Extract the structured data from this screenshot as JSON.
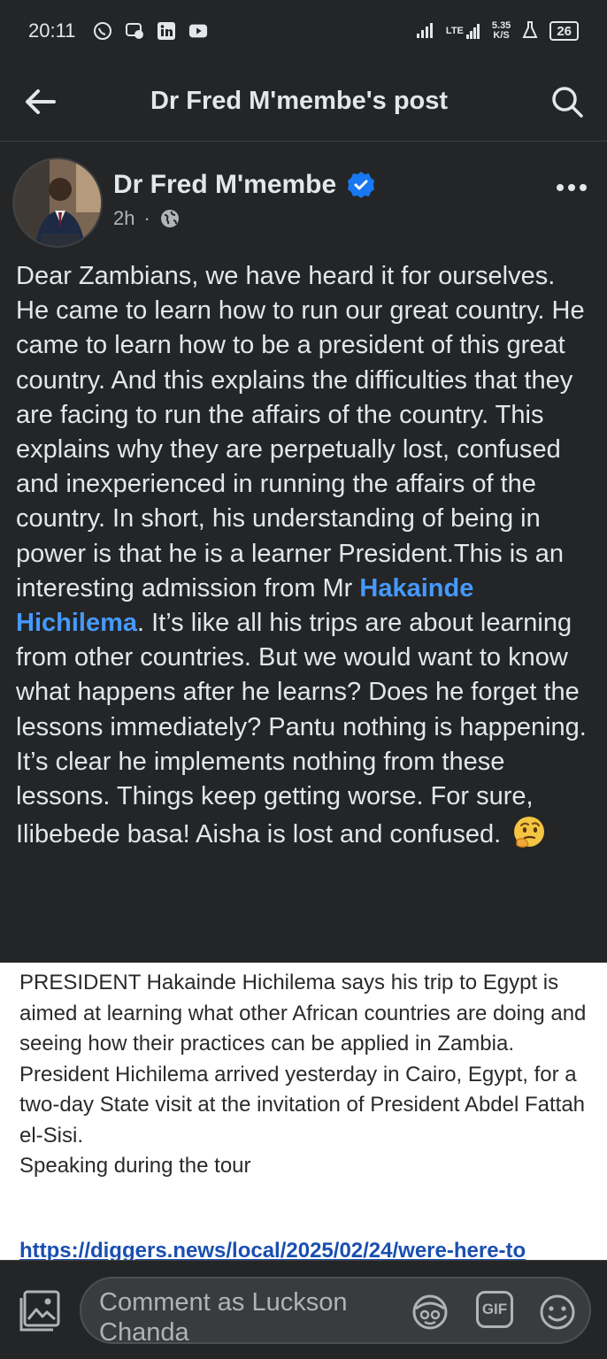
{
  "status_bar": {
    "time": "20:11",
    "net_speed_value": "5.35",
    "net_speed_unit": "K/S",
    "network": "LTE",
    "battery": "26"
  },
  "header": {
    "title": "Dr Fred M'membe's post"
  },
  "post": {
    "author": "Dr Fred M'membe",
    "time": "2h",
    "text_before_mention": "Dear Zambians, we have heard it for ourselves. He came to learn how to run our great country. He came to learn how to be a president of this great country. And this explains the difficulties that they are facing to run the affairs of the country. This explains why they are perpetually lost, confused and inexperienced in running the affairs of the country. In short, his understanding of being in power is that he is a learner President.This is an interesting admission from Mr ",
    "mention": "Hakainde Hichilema",
    "text_after_mention": ". It’s like all his trips are about learning from other countries. But we would want to know what happens after he learns? Does he forget the lessons immediately? Pantu nothing is happening. It’s clear he implements nothing from these lessons. Things keep getting worse. For sure, Ilibebede basa! Aisha is lost and confused. ",
    "emoji": "thinking-face"
  },
  "attachment": {
    "paragraph1": "PRESIDENT Hakainde Hichilema says his trip to Egypt is aimed at learning what other African countries are doing and seeing how their practices can be applied in Zambia.",
    "paragraph2": "President Hichilema arrived yesterday in Cairo, Egypt, for a two-day State visit at the invitation of President Abdel Fattah el-Sisi.",
    "paragraph3": "Speaking during the tour",
    "link": "https://diggers.news/local/2025/02/24/were-here-to"
  },
  "comment_bar": {
    "placeholder": "Comment as Luckson Chanda",
    "gif_label": "GIF"
  },
  "colors": {
    "background": "#242526",
    "text": "#e4e6eb",
    "secondary_text": "#b0b3b8",
    "mention": "#4599ff",
    "verified": "#1877f2"
  }
}
